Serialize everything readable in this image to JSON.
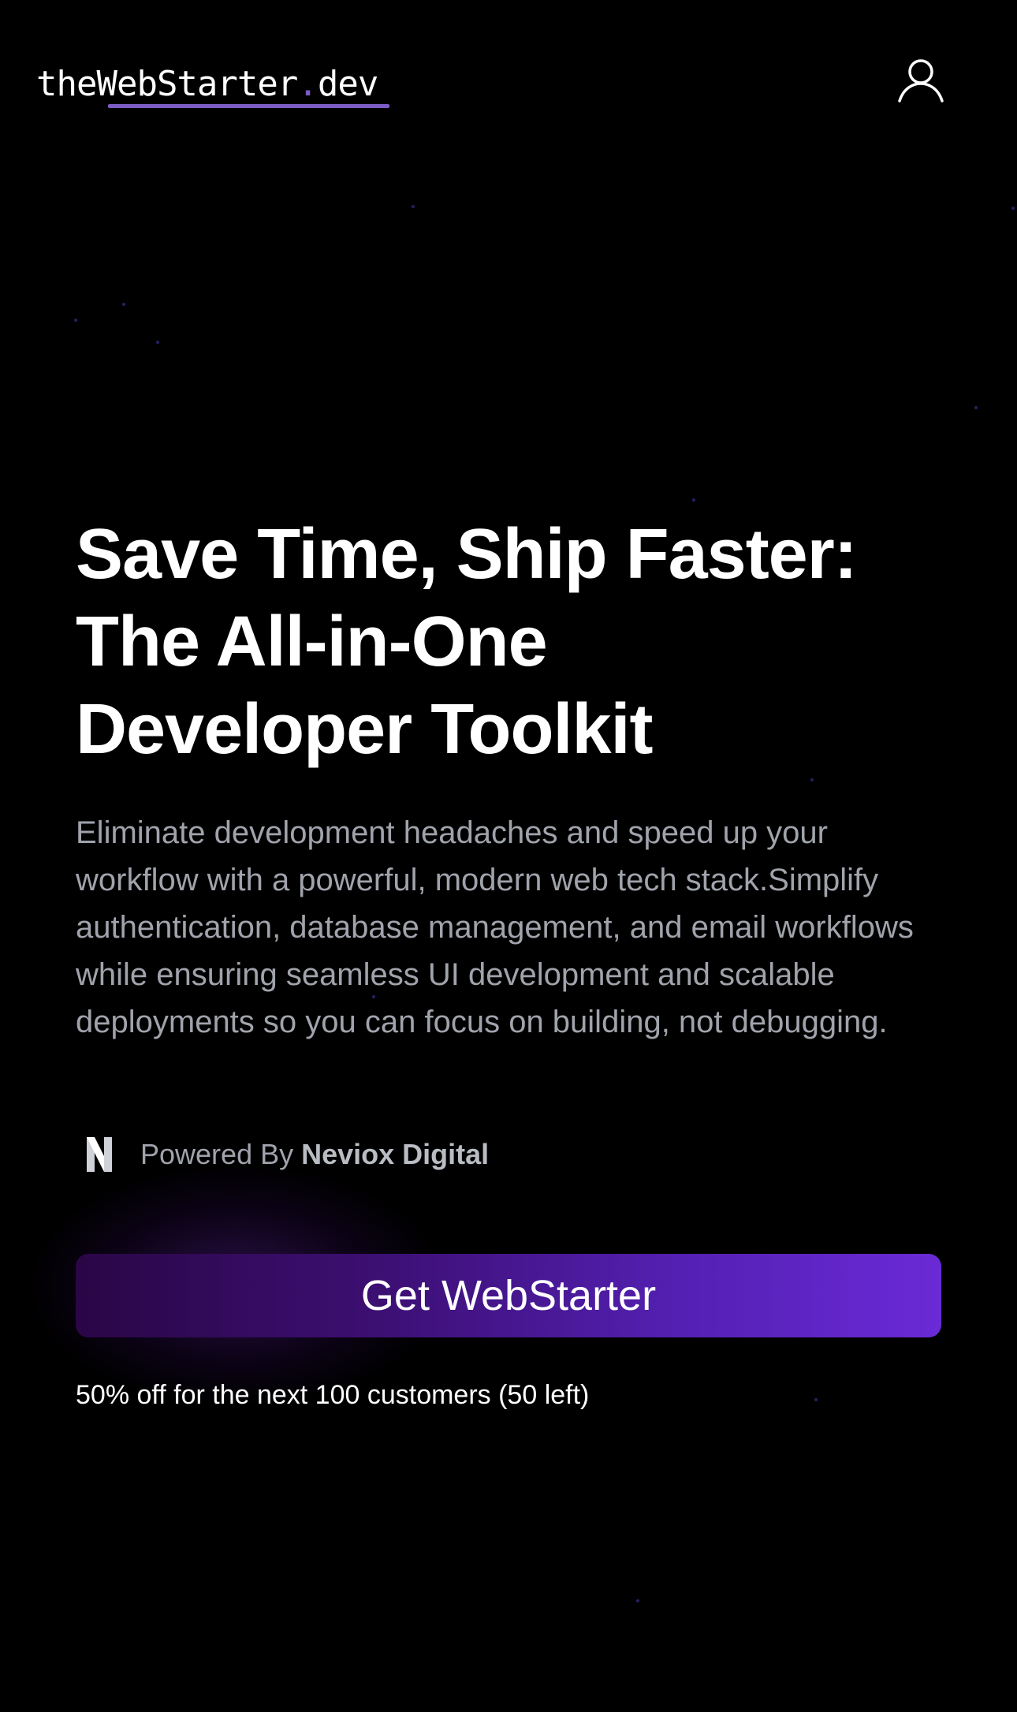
{
  "header": {
    "logo_prefix": "theWebStarter",
    "logo_dot": ".",
    "logo_suffix": "dev",
    "user_icon": "user-icon"
  },
  "hero": {
    "title_line_1": "Save Time, Ship Faster:",
    "title_line_2": "The All-in-One",
    "title_line_3": "Developer Toolkit",
    "description": "Eliminate development headaches and speed up your workflow with a powerful, modern web tech stack.Simplify authentication, database management, and email workflows while ensuring seamless UI development and scalable deployments so you can focus on building, not debugging."
  },
  "powered_by": {
    "label": "Powered By ",
    "brand": "Neviox Digital",
    "icon": "neviox-logo-icon"
  },
  "cta": {
    "button_label": "Get WebStarter",
    "promo": "50% off for the next 100 customers (50 left)"
  },
  "colors": {
    "background": "#000000",
    "accent": "#7c5cc4",
    "muted_text": "#a0a3ab",
    "button_start": "#2a0646",
    "button_end": "#6a2ad6"
  }
}
